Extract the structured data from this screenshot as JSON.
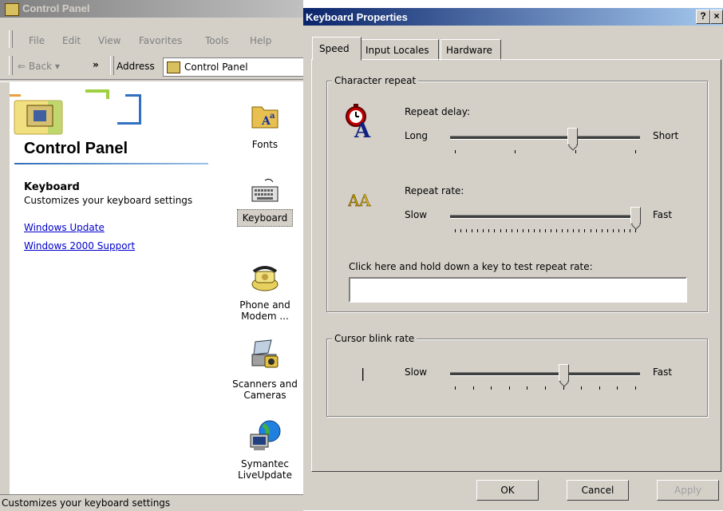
{
  "control_panel": {
    "title": "Control Panel",
    "menu": [
      "File",
      "Edit",
      "View",
      "Favorites",
      "Tools",
      "Help"
    ],
    "toolbar": {
      "back_label": "Back",
      "chevron": "»",
      "address_label": "Address",
      "address_value": "Control Panel"
    },
    "heading": "Control Panel",
    "selected_item": {
      "name": "Keyboard",
      "description": "Customizes your keyboard settings"
    },
    "links": [
      "Windows Update",
      "Windows 2000 Support"
    ],
    "icons": [
      {
        "label": "Fonts",
        "icon": "fonts-icon"
      },
      {
        "label": "Keyboard",
        "icon": "keyboard-icon"
      },
      {
        "label1": "Phone and",
        "label2": "Modem ...",
        "icon": "phone-icon"
      },
      {
        "label1": "Scanners and",
        "label2": "Cameras",
        "icon": "scanner-icon"
      },
      {
        "label1": "Symantec",
        "label2": "LiveUpdate",
        "icon": "liveupdate-icon"
      }
    ],
    "status": "Customizes your keyboard settings"
  },
  "keyboard_properties": {
    "title": "Keyboard Properties",
    "help_button": "?",
    "close_button": "×",
    "tabs": [
      "Speed",
      "Input Locales",
      "Hardware"
    ],
    "active_tab": "Speed",
    "character_repeat": {
      "title": "Character repeat",
      "repeat_delay": {
        "label": "Repeat delay:",
        "min_label": "Long",
        "max_label": "Short",
        "value_fraction": 0.65,
        "ticks": 4
      },
      "repeat_rate": {
        "label": "Repeat rate:",
        "min_label": "Slow",
        "max_label": "Fast",
        "value_fraction": 1.0,
        "ticks": 33
      },
      "test_label": "Click here and hold down a key to test repeat rate:",
      "test_value": ""
    },
    "cursor_blink": {
      "title": "Cursor blink rate",
      "cursor_glyph": "|",
      "min_label": "Slow",
      "max_label": "Fast",
      "value_fraction": 0.6,
      "ticks": 11
    },
    "buttons": {
      "ok": "OK",
      "cancel": "Cancel",
      "apply": "Apply"
    }
  },
  "colors": {
    "dialog_face": "#d4d0c8",
    "active_title": "#0a246a",
    "link": "#0000cc"
  }
}
